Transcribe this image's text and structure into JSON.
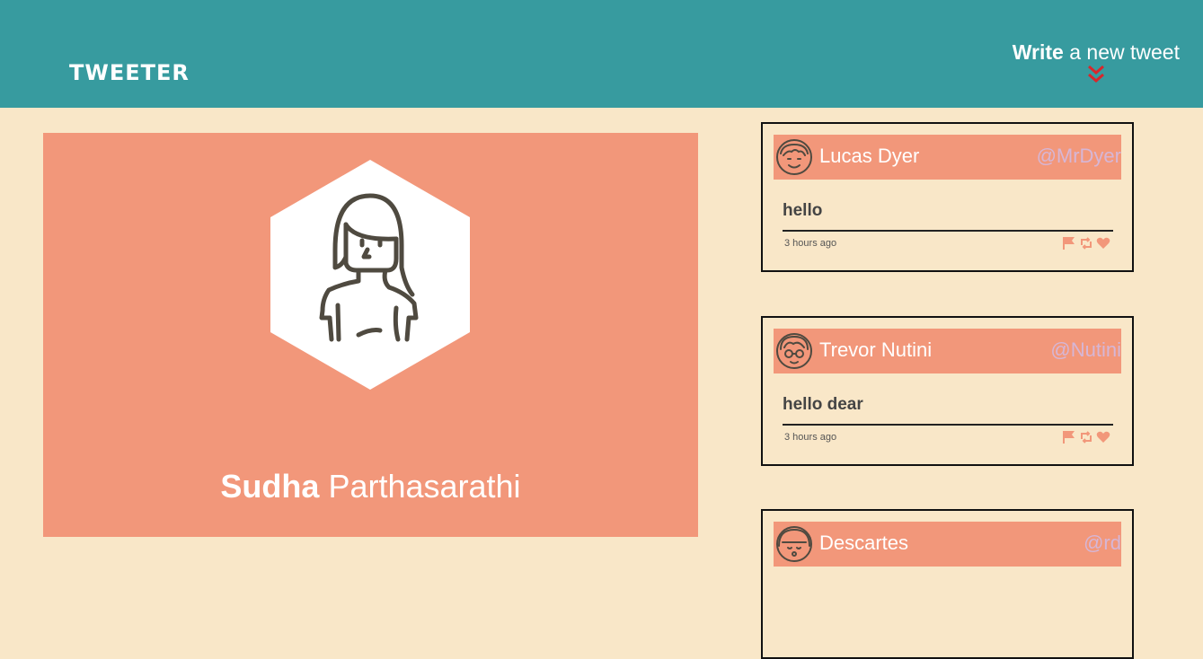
{
  "header": {
    "brand": "TWEETER",
    "compose_bold": "Write",
    "compose_rest": " a new tweet",
    "compose_icon": "double-chevron-down-icon"
  },
  "profile": {
    "first_name": "Sudha",
    "last_name": " Parthasarathi",
    "avatar_icon": "woman-avatar-icon"
  },
  "tweets": [
    {
      "name": "Lucas Dyer",
      "handle": "@MrDyer",
      "text": "hello",
      "time": "3 hours ago",
      "avatar_icon": "boy-avatar-icon"
    },
    {
      "name": "Trevor Nutini",
      "handle": "@Nutini",
      "text": "hello dear",
      "time": "3 hours ago",
      "avatar_icon": "glasses-avatar-icon"
    },
    {
      "name": "Descartes",
      "handle": "@rd",
      "text": "",
      "time": "",
      "avatar_icon": "girl-avatar-icon"
    }
  ],
  "colors": {
    "header_bg": "#379b9f",
    "page_bg": "#f9e7c8",
    "accent_salmon": "#f2977a",
    "chevron_red": "#d9262b"
  }
}
